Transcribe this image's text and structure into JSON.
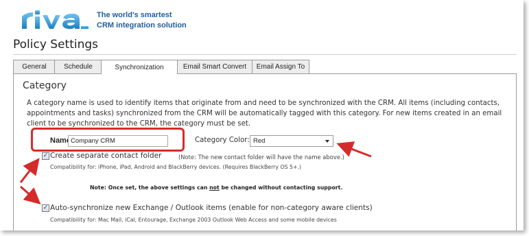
{
  "header": {
    "logo_text": "riva",
    "tagline_line1": "The world's smartest",
    "tagline_line2": "CRM integration solution"
  },
  "page": {
    "title": "Policy Settings"
  },
  "tabs": [
    {
      "label": "General",
      "active": false
    },
    {
      "label": "Schedule",
      "active": false
    },
    {
      "label": "Synchronization",
      "active": true
    },
    {
      "label": "Email Smart Convert",
      "active": false
    },
    {
      "label": "Email Assign To",
      "active": false
    }
  ],
  "category": {
    "heading": "Category",
    "description": "A category name is used to identify items that originate from and need to be synchronized with the CRM. All items (including contacts, appointments and tasks) synchronized from the CRM will be automatically tagged with this category. For new items created in an email client to be synchronized to the CRM, the category must be set.",
    "name_label": "Name:",
    "name_value": "Company CRM",
    "color_label": "Category Color:",
    "color_value": "Red"
  },
  "options": {
    "contact_folder": {
      "checked": true,
      "label": "Create separate contact folder",
      "note": "(Note: The new contact folder will have the name above.)",
      "compat": "Compatibility for: iPhone, iPad, Android and BlackBerry devices. (Requires BlackBerry OS 5+.)"
    },
    "warning_before": "Note: Once set, the above settings can ",
    "warning_emph": "not",
    "warning_after": " be changed without contacting support.",
    "auto_sync": {
      "checked": true,
      "label": "Auto-synchronize new Exchange / Outlook items (enable for non-category aware clients)",
      "compat": "Compatibility for: Mac Mail, iCal, Entourage, Exchange 2003 Outlook Web Access and some mobile devices"
    }
  },
  "colors": {
    "brand_blue": "#1f5d9e",
    "annotation_red": "#d62b2b",
    "checkmark": "#1b2f9a"
  }
}
